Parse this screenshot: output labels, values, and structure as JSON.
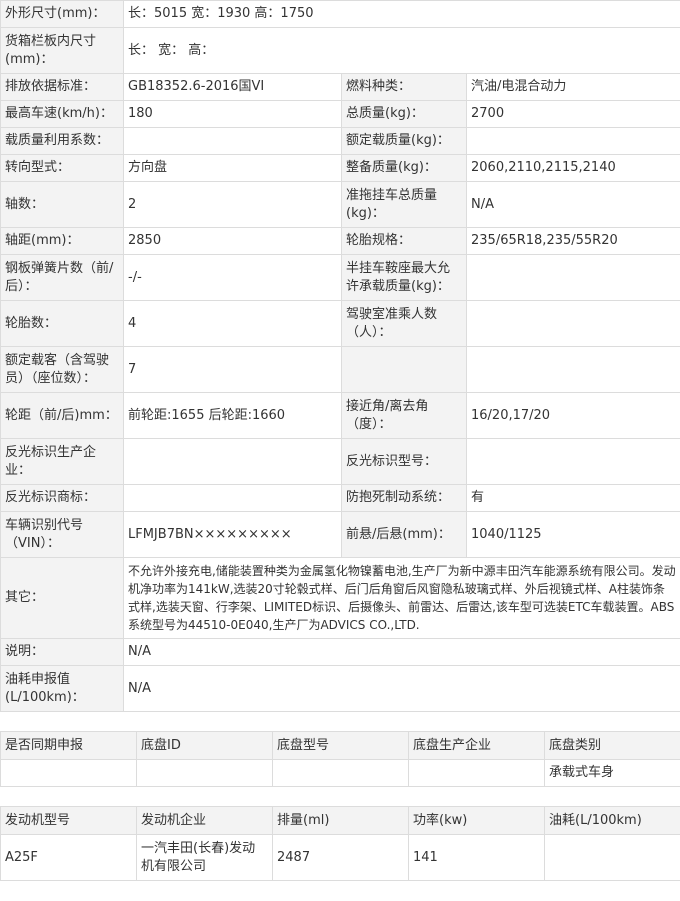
{
  "spec": {
    "dimensions": {
      "label": "外形尺寸(mm)：",
      "value": "长：5015 宽：1930 高：1750"
    },
    "cargo_box": {
      "label": "货箱栏板内尺寸(mm)：",
      "value": "长： 宽： 高："
    },
    "rows": [
      {
        "l1": "排放依据标准：",
        "v1": "GB18352.6-2016国VI",
        "l2": "燃料种类：",
        "v2": "汽油/电混合动力"
      },
      {
        "l1": "最高车速(km/h)：",
        "v1": "180",
        "l2": "总质量(kg)：",
        "v2": "2700"
      },
      {
        "l1": "载质量利用系数：",
        "v1": "",
        "l2": "额定载质量(kg)：",
        "v2": ""
      },
      {
        "l1": "转向型式：",
        "v1": "方向盘",
        "l2": "整备质量(kg)：",
        "v2": "2060,2110,2115,2140"
      },
      {
        "l1": "轴数：",
        "v1": "2",
        "l2": "准拖挂车总质量(kg)：",
        "v2": "N/A"
      },
      {
        "l1": "轴距(mm)：",
        "v1": "2850",
        "l2": "轮胎规格：",
        "v2": "235/65R18,235/55R20"
      },
      {
        "l1": "钢板弹簧片数（前/后）：",
        "v1": "-/-",
        "l2": "半挂车鞍座最大允许承载质量(kg)：",
        "v2": ""
      },
      {
        "l1": "轮胎数：",
        "v1": "4",
        "l2": "驾驶室准乘人数（人）：",
        "v2": ""
      },
      {
        "l1": "额定载客（含驾驶员）（座位数）：",
        "v1": "7",
        "l2": "",
        "v2": ""
      },
      {
        "l1": "轮距（前/后)mm：",
        "v1": "前轮距:1655 后轮距:1660",
        "l2": "接近角/离去角（度）：",
        "v2": "16/20,17/20"
      },
      {
        "l1": "反光标识生产企业：",
        "v1": "",
        "l2": "反光标识型号：",
        "v2": ""
      },
      {
        "l1": "反光标识商标：",
        "v1": "",
        "l2": "防抱死制动系统：",
        "v2": "有"
      },
      {
        "l1": "车辆识别代号（VIN）：",
        "v1": "LFMJB7BN×××××××××",
        "l2": "前悬/后悬(mm)：",
        "v2": "1040/1125"
      }
    ],
    "other": {
      "label": "其它：",
      "value": "不允许外接充电,储能装置种类为金属氢化物镍蓄电池,生产厂为新中源丰田汽车能源系统有限公司。发动机净功率为141kW,选装20寸轮毂式样、后门后角窗后风窗隐私玻璃式样、外后视镜式样、A柱装饰条式样,选装天窗、行李架、LIMITED标识、后摄像头、前雷达、后雷达,该车型可选装ETC车载装置。ABS系统型号为44510-0E040,生产厂为ADVICS CO.,LTD."
    },
    "note": {
      "label": "说明：",
      "value": "N/A"
    },
    "fuel": {
      "label": "油耗申报值(L/100km)：",
      "value": "N/A"
    }
  },
  "chassis": {
    "headers": [
      "是否同期申报",
      "底盘ID",
      "底盘型号",
      "底盘生产企业",
      "底盘类别"
    ],
    "row": [
      "",
      "",
      "",
      "",
      "承载式车身"
    ]
  },
  "engine": {
    "headers": [
      "发动机型号",
      "发动机企业",
      "排量(ml)",
      "功率(kw)",
      "油耗(L/100km)"
    ],
    "row": [
      "A25F",
      "一汽丰田(长春)发动机有限公司",
      "2487",
      "141",
      ""
    ]
  }
}
